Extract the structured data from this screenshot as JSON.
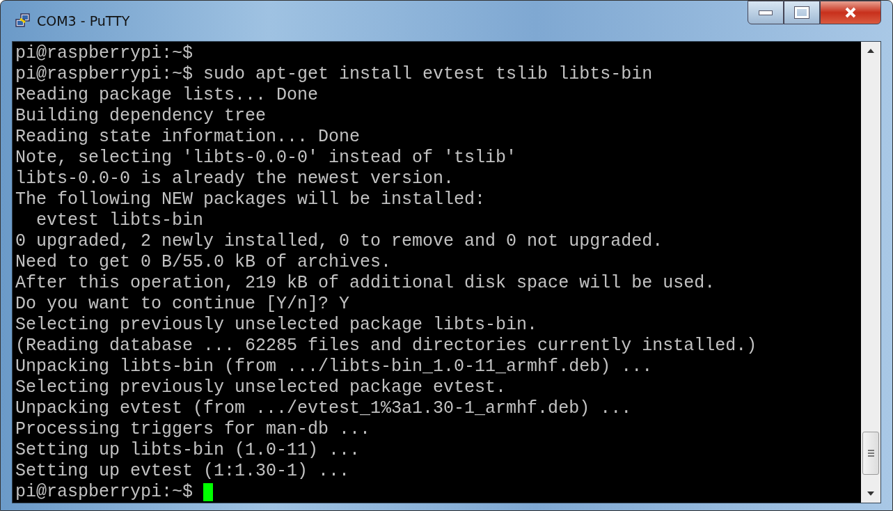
{
  "window": {
    "title": "COM3 - PuTTY"
  },
  "terminal": {
    "lines": [
      "pi@raspberrypi:~$",
      "pi@raspberrypi:~$ sudo apt-get install evtest tslib libts-bin",
      "Reading package lists... Done",
      "Building dependency tree",
      "Reading state information... Done",
      "Note, selecting 'libts-0.0-0' instead of 'tslib'",
      "libts-0.0-0 is already the newest version.",
      "The following NEW packages will be installed:",
      "  evtest libts-bin",
      "0 upgraded, 2 newly installed, 0 to remove and 0 not upgraded.",
      "Need to get 0 B/55.0 kB of archives.",
      "After this operation, 219 kB of additional disk space will be used.",
      "Do you want to continue [Y/n]? Y",
      "Selecting previously unselected package libts-bin.",
      "(Reading database ... 62285 files and directories currently installed.)",
      "Unpacking libts-bin (from .../libts-bin_1.0-11_armhf.deb) ...",
      "Selecting previously unselected package evtest.",
      "Unpacking evtest (from .../evtest_1%3a1.30-1_armhf.deb) ...",
      "Processing triggers for man-db ...",
      "Setting up libts-bin (1.0-11) ...",
      "Setting up evtest (1:1.30-1) ...",
      "pi@raspberrypi:~$ "
    ],
    "cursor": true
  }
}
